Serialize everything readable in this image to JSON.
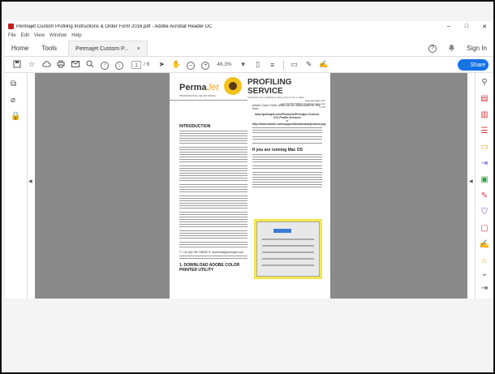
{
  "window": {
    "title": "Permajet Custom Profiling Instructions & Order Form 2016.pdf - Adobe Acrobat Reader DC",
    "min": "–",
    "max": "□",
    "close": "✕"
  },
  "menu": [
    "File",
    "Edit",
    "View",
    "Window",
    "Help"
  ],
  "tabs": {
    "home": "Home",
    "tools": "Tools",
    "doc": "Permajet Custom P...",
    "doc_close": "×",
    "help_icon": "?",
    "bell_icon": "♪",
    "sign_in": "Sign In"
  },
  "toolbar": {
    "page_current": "1",
    "page_total": "/ 6",
    "zoom": "46.3%",
    "share": "Share"
  },
  "doc": {
    "logo_perma": "Perma",
    "logo_jet": "Jet",
    "logo_tag": "PROFESSIONAL INKJET MEDIA",
    "service_title": "PROFILING SERVICE",
    "service_sub": "Instructions for installing & using custom ICC profiles",
    "website": "www.permajet.com",
    "contact": "+44 (0)1789 768000 | info@permajet.com",
    "page_of": "1 of 6",
    "intro_heading": "INTRODUCTION",
    "step_heading": "1. DOWNLOAD ADOBE COLOR PRINTER UTILITY",
    "col2_first": "Adobe Color Printer Utility can be downloaded for free from:",
    "link1": "http://permajet.com/Products/Permajet-Custom-ICC-Profile-Services",
    "or": "or",
    "link2": "http://www.adobe.com/support/downloads/product.jsp",
    "mac_heading": "If you are running Mac OS",
    "contact_line": "T: +44 (0)1789 768000  E: technical@permajet.com"
  },
  "colors": {
    "accent": "#1473e6",
    "acrobat_red": "#d7373f",
    "doc_bg": "#8a8a8a",
    "yellow": "#f7e64a"
  }
}
